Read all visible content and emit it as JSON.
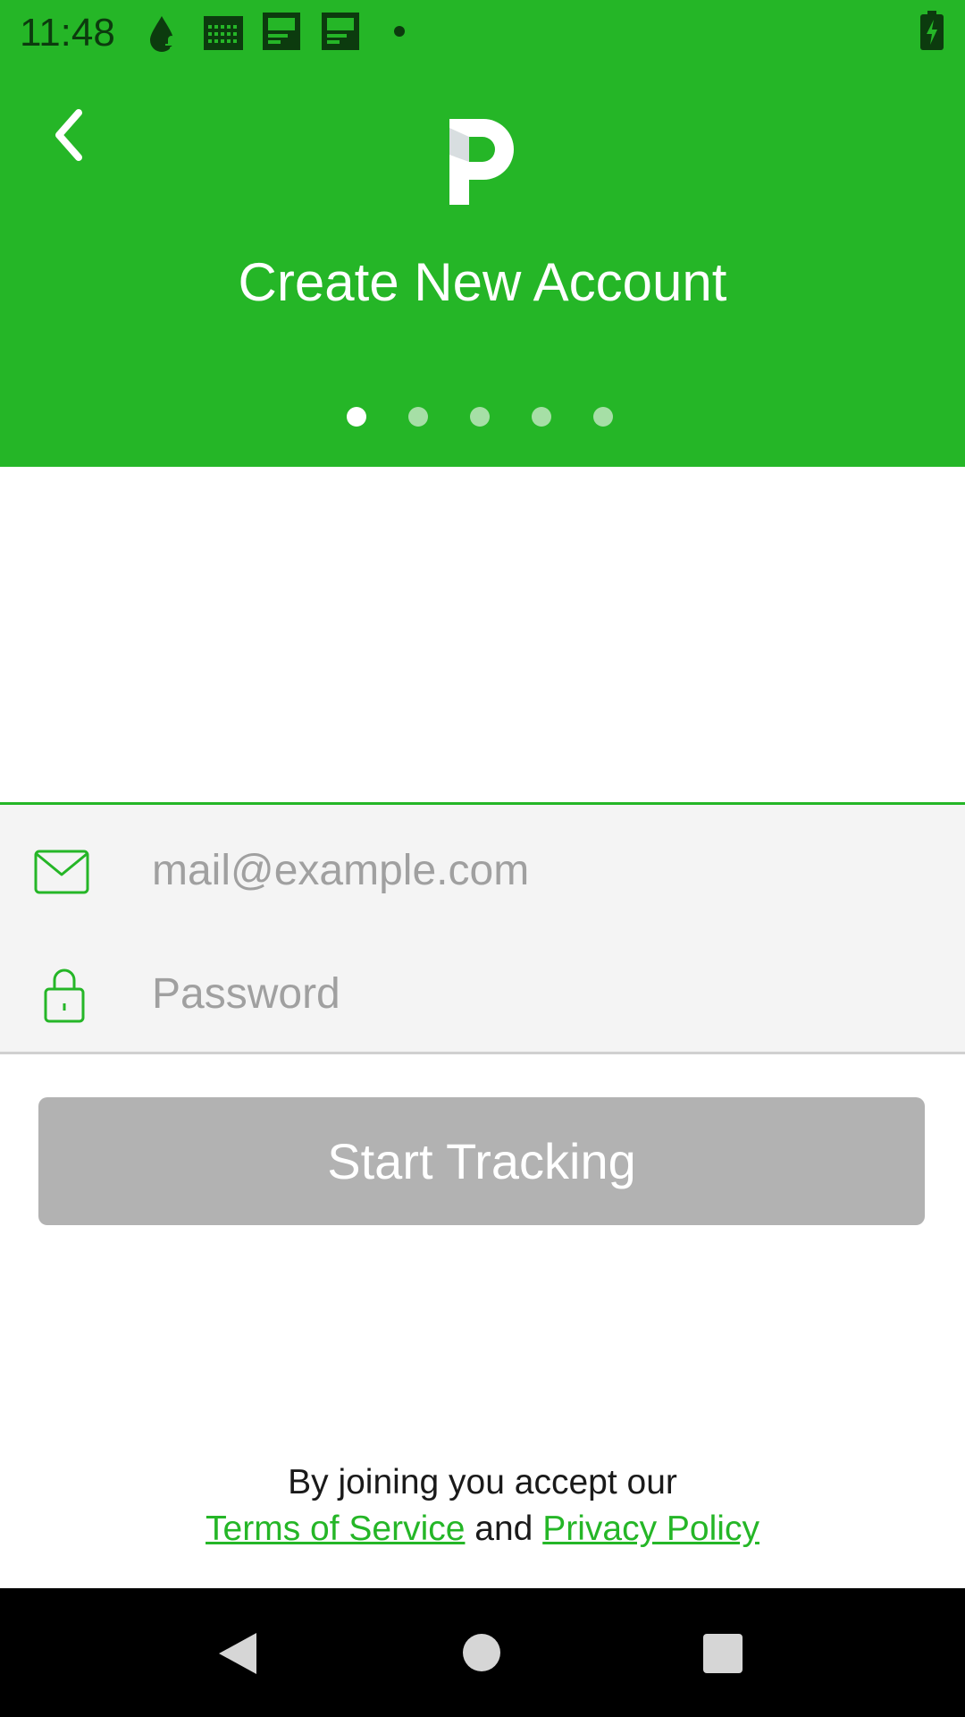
{
  "status_bar": {
    "time": "11:48",
    "icons": [
      "notification-drop-icon",
      "calendar-icon",
      "document-icon",
      "document-icon",
      "dot-icon",
      "battery-charging-icon"
    ]
  },
  "header": {
    "back_icon": "chevron-left-icon",
    "logo_icon": "p-logo-icon",
    "title": "Create New Account",
    "page_indicator": {
      "count": 5,
      "active_index": 0
    },
    "background_color": "#25b627"
  },
  "form": {
    "email": {
      "icon": "envelope-icon",
      "value": "",
      "placeholder": "mail@example.com"
    },
    "password": {
      "icon": "lock-icon",
      "value": "",
      "placeholder": "Password"
    },
    "submit_label": "Start Tracking",
    "submit_color": "#b2b2b2"
  },
  "legal": {
    "line1": "By joining you accept our",
    "terms_link": "Terms of Service",
    "and": "and",
    "privacy_link": "Privacy Policy"
  },
  "nav_bar": {
    "icons": [
      "back-triangle-icon",
      "home-circle-icon",
      "recents-square-icon"
    ]
  }
}
